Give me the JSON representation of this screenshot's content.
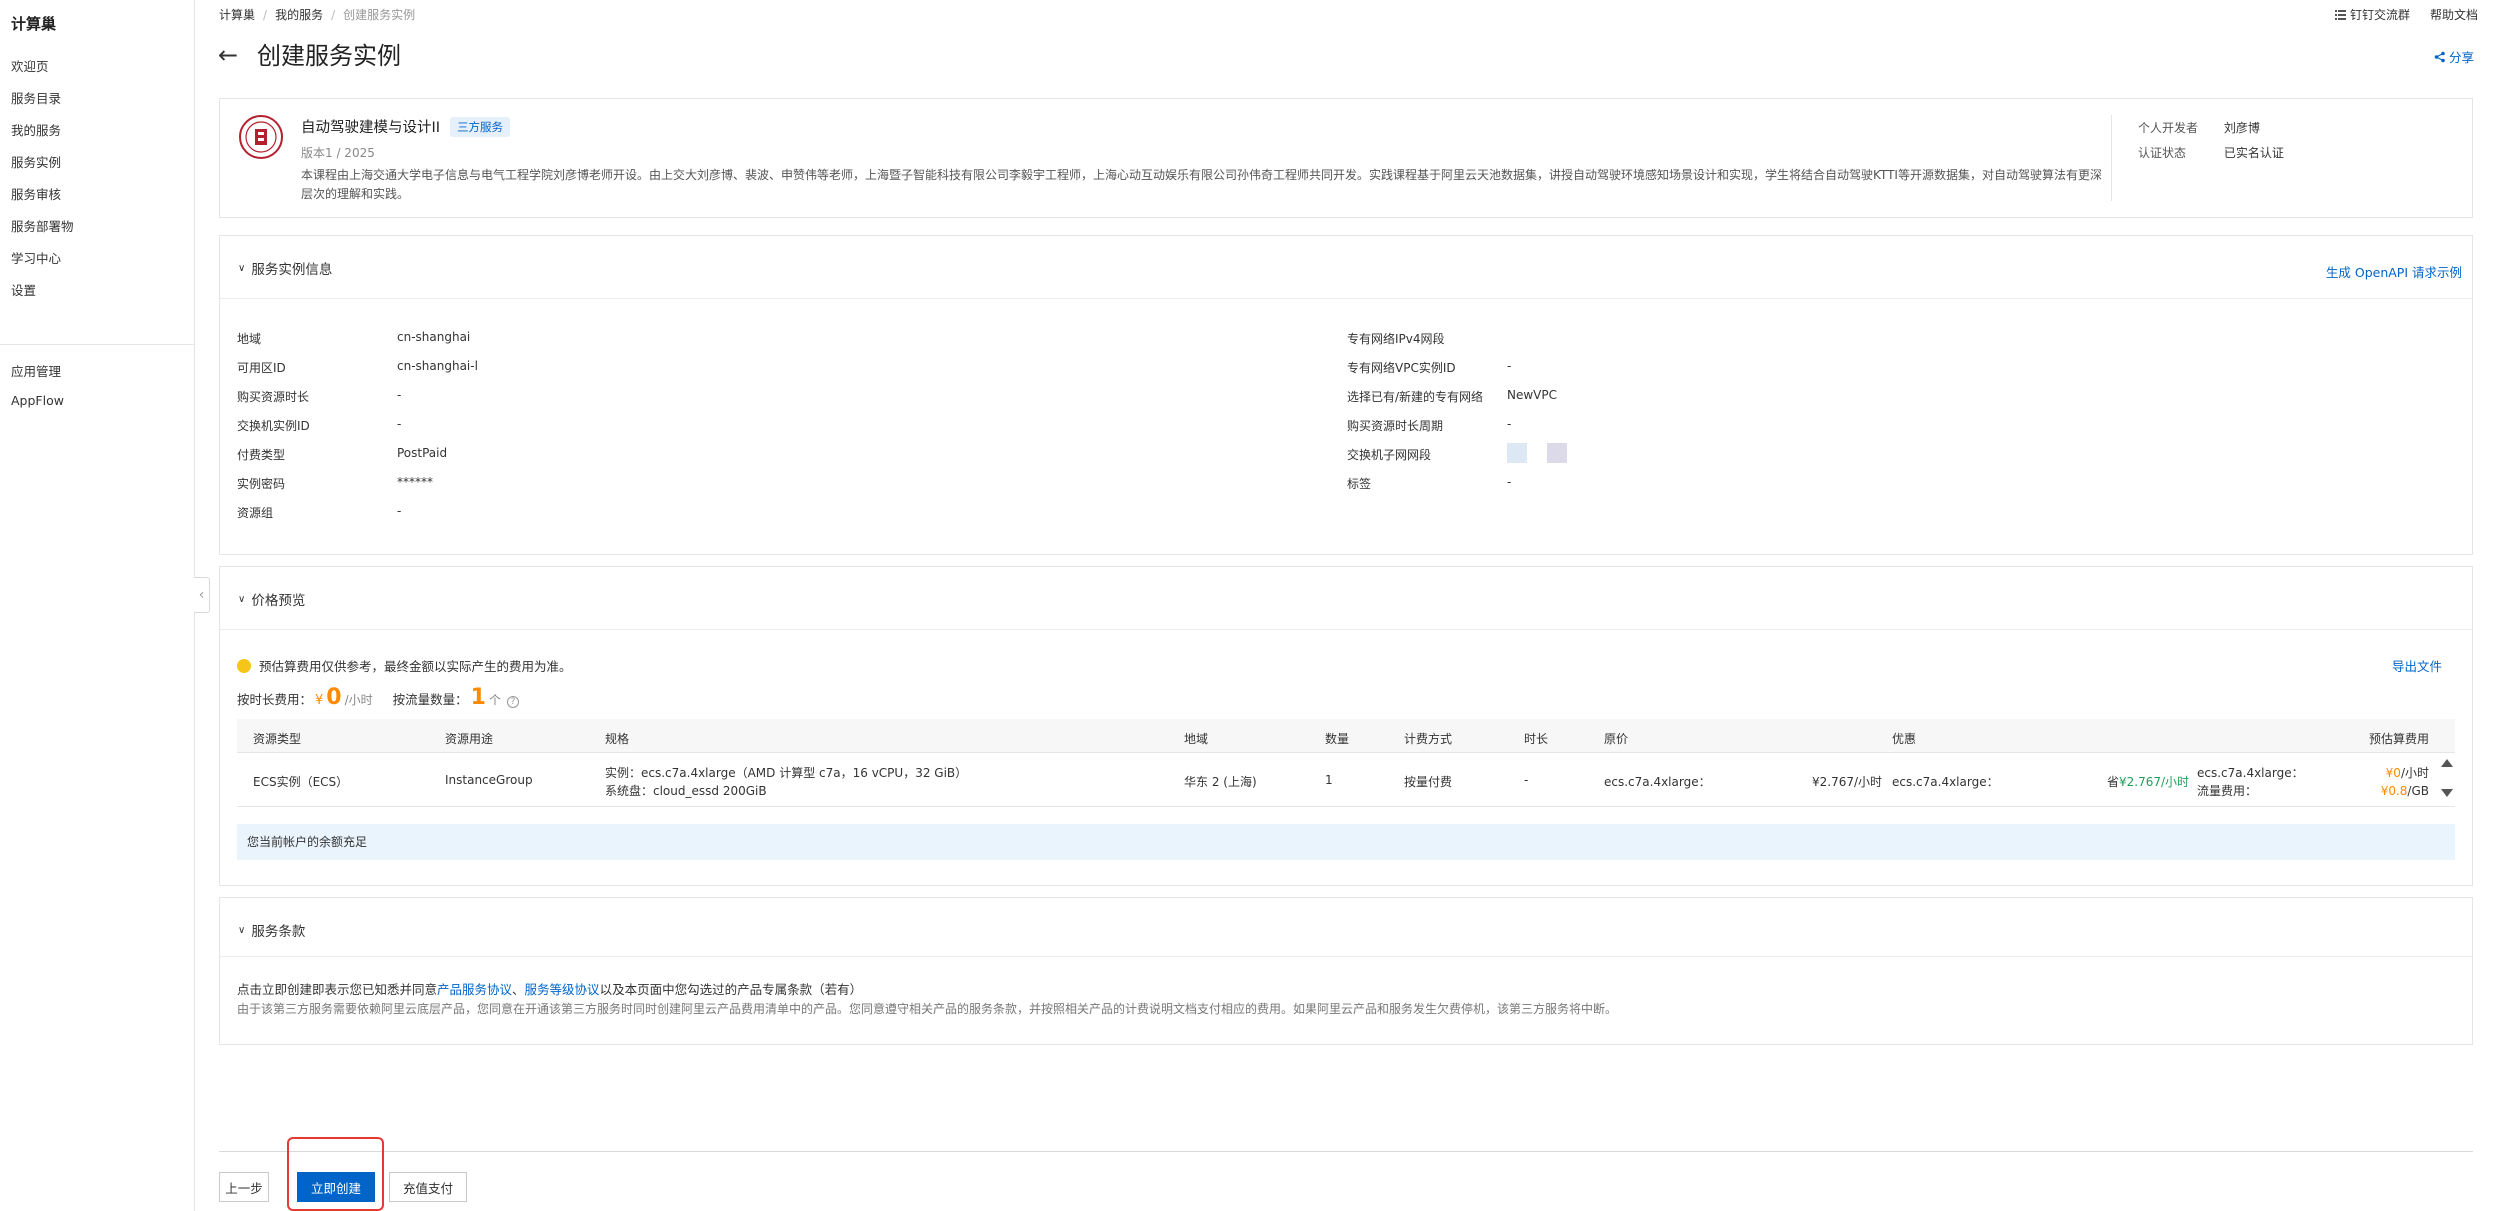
{
  "sidebar": {
    "title": "计算巢",
    "items": [
      {
        "label": "欢迎页"
      },
      {
        "label": "服务目录"
      },
      {
        "label": "我的服务"
      },
      {
        "label": "服务实例"
      },
      {
        "label": "服务审核"
      },
      {
        "label": "服务部署物"
      },
      {
        "label": "学习中心"
      },
      {
        "label": "设置"
      }
    ],
    "items2": [
      {
        "label": "应用管理"
      },
      {
        "label": "AppFlow"
      }
    ]
  },
  "breadcrumb": [
    "计算巢",
    "我的服务",
    "创建服务实例"
  ],
  "top_links": {
    "dingtalk": "钉钉交流群",
    "help": "帮助文档"
  },
  "page": {
    "title": "创建服务实例",
    "share": "分享"
  },
  "service": {
    "name": "自动驾驶建模与设计II",
    "badge": "三方服务",
    "version": "版本1 / 2025",
    "description": "本课程由上海交通大学电子信息与电气工程学院刘彦博老师开设。由上交大刘彦博、裴波、申赞伟等老师，上海暨子智能科技有限公司李毅宇工程师，上海心动互动娱乐有限公司孙伟奇工程师共同开发。实践课程基于阿里云天池数据集，讲授自动驾驶环境感知场景设计和实现，学生将结合自动驾驶KTTI等开源数据集，对自动驾驶算法有更深层次的理解和实践。",
    "developer_label": "个人开发者",
    "developer": "刘彦博",
    "auth_label": "认证状态",
    "auth": "已实名认证"
  },
  "instance_info": {
    "title": "服务实例信息",
    "openapi": "生成 OpenAPI 请求示例",
    "left": [
      {
        "k": "地域",
        "v": "cn-shanghai"
      },
      {
        "k": "可用区ID",
        "v": "cn-shanghai-l"
      },
      {
        "k": "购买资源时长",
        "v": "-"
      },
      {
        "k": "交换机实例ID",
        "v": "-"
      },
      {
        "k": "付费类型",
        "v": "PostPaid"
      },
      {
        "k": "实例密码",
        "v": "******"
      },
      {
        "k": "资源组",
        "v": "-"
      }
    ],
    "right": [
      {
        "k": "专有网络IPv4网段",
        "v": ""
      },
      {
        "k": "专有网络VPC实例ID",
        "v": "-"
      },
      {
        "k": "选择已有/新建的专有网络",
        "v": "NewVPC"
      },
      {
        "k": "购买资源时长周期",
        "v": "-"
      },
      {
        "k": "交换机子网网段",
        "v": ""
      },
      {
        "k": "标签",
        "v": "-"
      }
    ]
  },
  "price": {
    "title": "价格预览",
    "notice": "预估算费用仅供参考，最终金额以实际产生的费用为准。",
    "export": "导出文件",
    "hourly_label": "按时长费用：",
    "currency": "¥",
    "hourly_value": "0",
    "hourly_unit": "/小时",
    "flow_label": "按流量数量：",
    "flow_value": "1",
    "flow_unit": "个",
    "headers": [
      "资源类型",
      "资源用途",
      "规格",
      "地域",
      "数量",
      "计费方式",
      "时长",
      "原价",
      "优惠",
      "预估算费用"
    ],
    "row": {
      "type": "ECS实例（ECS）",
      "usage": "InstanceGroup",
      "spec1": "实例：ecs.c7a.4xlarge（AMD 计算型 c7a，16 vCPU，32 GiB）",
      "spec2": "系统盘：cloud_essd 200GiB",
      "region": "华东 2 (上海)",
      "qty": "1",
      "billing": "按量付费",
      "duration": "-",
      "orig_name": "ecs.c7a.4xlarge：",
      "orig_price": "¥2.767/小时",
      "disc_name": "ecs.c7a.4xlarge：",
      "disc_prefix": "省",
      "disc_price": "¥2.767/小时",
      "est_name1": "ecs.c7a.4xlarge：",
      "est_name2": "流量费用：",
      "est_val1": "¥0",
      "est_unit1": "/小时",
      "est_val2": "¥0.8",
      "est_unit2": "/GB"
    },
    "balance": "您当前帐户的余额充足"
  },
  "terms": {
    "title": "服务条款",
    "line1_pre": "点击立即创建即表示您已知悉并同意",
    "link1": "产品服务协议",
    "sep": "、",
    "link2": "服务等级协议",
    "line1_post": "以及本页面中您勾选过的产品专属条款（若有）",
    "line2": "由于该第三方服务需要依赖阿里云底层产品，您同意在开通该第三方服务时同时创建阿里云产品费用清单中的产品。您同意遵守相关产品的服务条款，并按照相关产品的计费说明文档支付相应的费用。如果阿里云产品和服务发生欠费停机，该第三方服务将中断。"
  },
  "footer": {
    "prev": "上一步",
    "create": "立即创建",
    "recharge": "充值支付"
  },
  "colors": {
    "primary": "#0064c8",
    "accent": "#ff8a00",
    "green": "#1ea05a",
    "highlight": "#e53935"
  }
}
